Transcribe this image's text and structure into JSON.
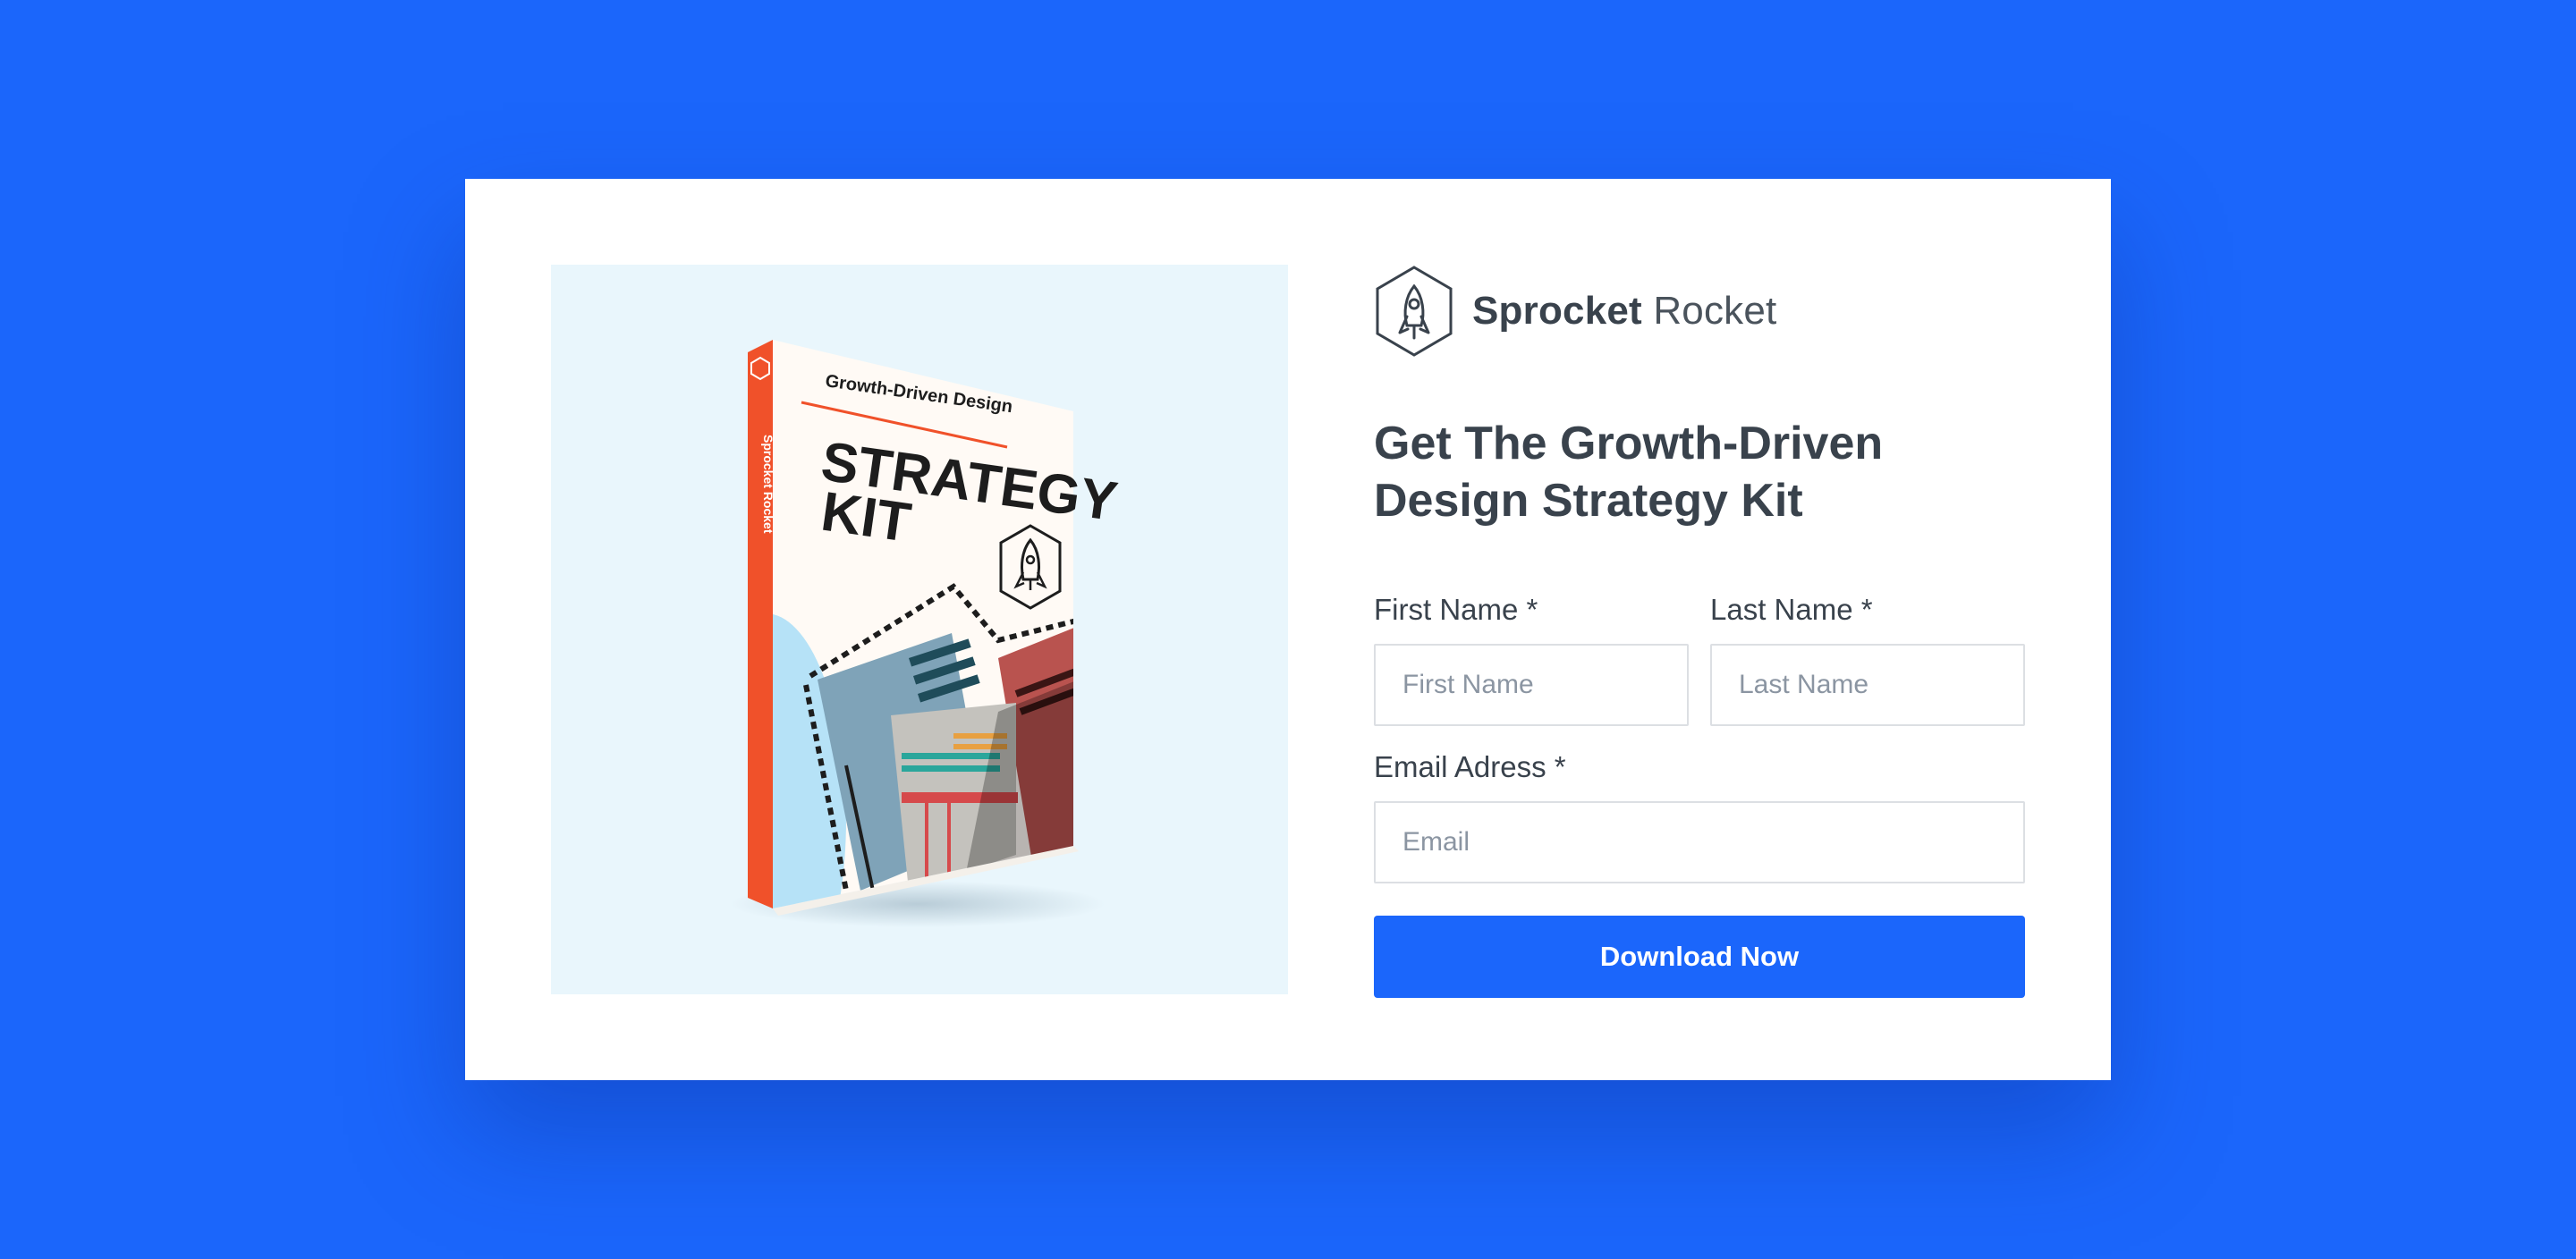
{
  "brand": {
    "name_strong": "Sprocket",
    "name_light": "Rocket",
    "logo_icon": "rocket-hexagon-icon"
  },
  "book": {
    "subtitle": "Growth-Driven Design",
    "title_line1": "STRATEGY",
    "title_line2": "KIT",
    "spine_text": "Sprocket Rocket"
  },
  "form": {
    "headline": "Get The Growth-Driven Design Strategy Kit",
    "first_name": {
      "label": "First Name *",
      "placeholder": "First Name",
      "value": ""
    },
    "last_name": {
      "label": "Last Name *",
      "placeholder": "Last Name",
      "value": ""
    },
    "email": {
      "label": "Email Adress *",
      "placeholder": "Email",
      "value": ""
    },
    "submit_label": "Download Now"
  },
  "colors": {
    "page_background": "#1b66fb",
    "card": "#ffffff",
    "image_panel": "#e9f6fc",
    "text": "#39424c",
    "button": "#1b66fb",
    "book_spine": "#f0512a"
  }
}
